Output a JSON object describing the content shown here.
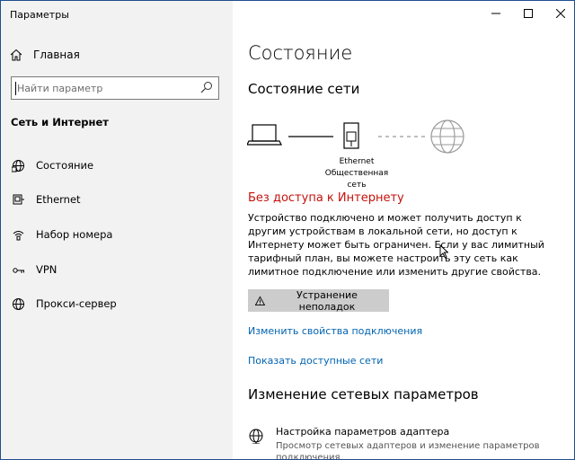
{
  "window": {
    "title": "Параметры"
  },
  "sidebar": {
    "home_label": "Главная",
    "search_placeholder": "Найти параметр",
    "section_title": "Сеть и Интернет",
    "items": [
      {
        "label": "Состояние",
        "icon": "globe-network-icon"
      },
      {
        "label": "Ethernet",
        "icon": "ethernet-icon"
      },
      {
        "label": "Набор номера",
        "icon": "dialup-icon"
      },
      {
        "label": "VPN",
        "icon": "vpn-icon"
      },
      {
        "label": "Прокси-сервер",
        "icon": "globe-icon"
      }
    ]
  },
  "content": {
    "page_title": "Состояние",
    "network_status_title": "Состояние сети",
    "diagram": {
      "adapter_name": "Ethernet",
      "network_type": "Общественная сеть"
    },
    "status_heading": "Без доступа к Интернету",
    "status_description": "Устройство подключено и может получить доступ к другим устройствам в локальной сети, но доступ к Интернету может быть ограничен. Если у вас лимитный тарифный план, вы можете настроить эту сеть как лимитное подключение или изменить другие свойства.",
    "troubleshoot_label": "Устранение неполадок",
    "links": {
      "change_properties": "Изменить свойства подключения",
      "show_networks": "Показать доступные сети"
    },
    "change_settings_title": "Изменение сетевых параметров",
    "adapter": {
      "title": "Настройка параметров адаптера",
      "description": "Просмотр сетевых адаптеров и изменение параметров подключения."
    }
  },
  "colors": {
    "sidebar_bg": "#f2f2f2",
    "link": "#0063b1",
    "error": "#c4120c",
    "button_bg": "#cccccc"
  }
}
